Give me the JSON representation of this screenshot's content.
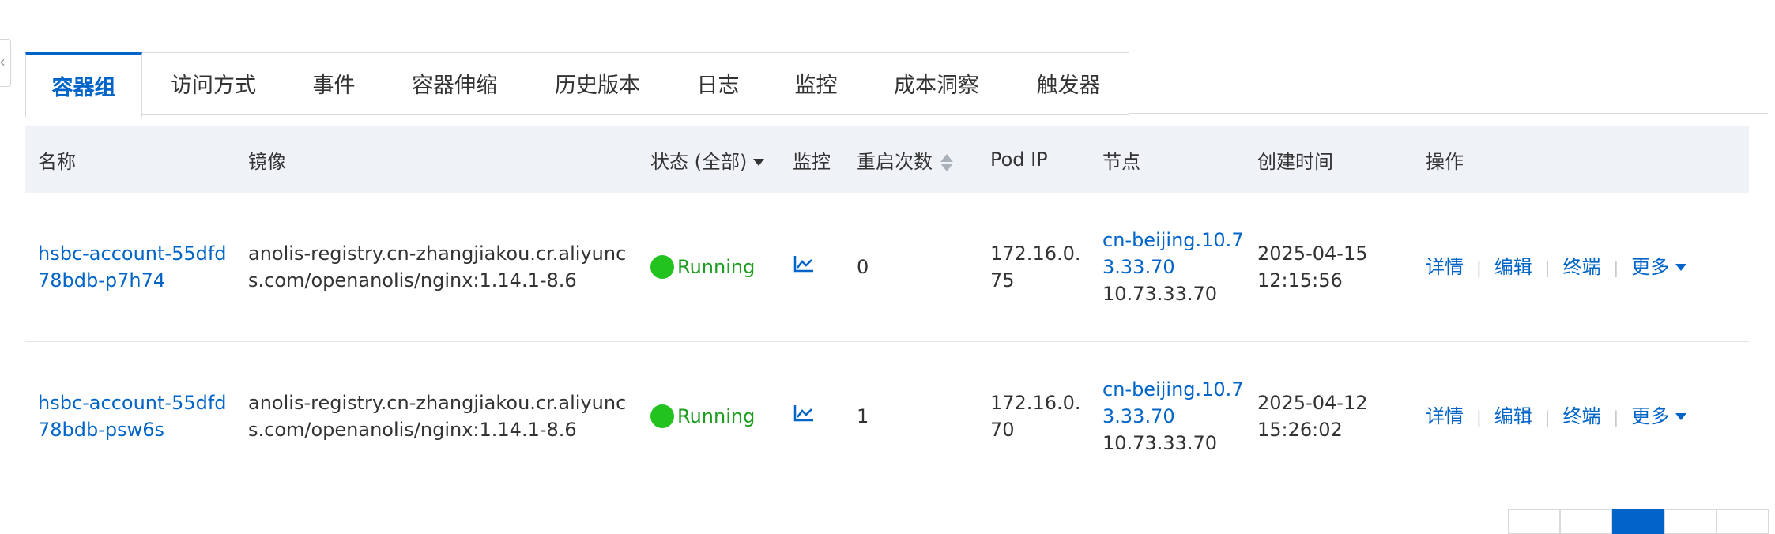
{
  "tabs": [
    "容器组",
    "访问方式",
    "事件",
    "容器伸缩",
    "历史版本",
    "日志",
    "监控",
    "成本洞察",
    "触发器"
  ],
  "table": {
    "headers": {
      "name": "名称",
      "image": "镜像",
      "status": "状态 (全部)",
      "monitor": "监控",
      "restarts": "重启次数",
      "pod_ip": "Pod IP",
      "node": "节点",
      "created": "创建时间",
      "actions": "操作"
    },
    "rows": [
      {
        "name": "hsbc-account-55dfd78bdb-p7h74",
        "image": "anolis-registry.cn-zhangjiakou.cr.aliyuncs.com/openanolis/nginx:1.14.1-8.6",
        "status": "Running",
        "restarts": "0",
        "pod_ip": "172.16.0.75",
        "node_name": "cn-beijing.10.73.33.70",
        "node_ip": "10.73.33.70",
        "created_date": "2025-04-15",
        "created_time": "12:15:56"
      },
      {
        "name": "hsbc-account-55dfd78bdb-psw6s",
        "image": "anolis-registry.cn-zhangjiakou.cr.aliyuncs.com/openanolis/nginx:1.14.1-8.6",
        "status": "Running",
        "restarts": "1",
        "pod_ip": "172.16.0.70",
        "node_name": "cn-beijing.10.73.33.70",
        "node_ip": "10.73.33.70",
        "created_date": "2025-04-12",
        "created_time": "15:26:02"
      }
    ],
    "actions": {
      "details": "详情",
      "edit": "编辑",
      "terminal": "终端",
      "more": "更多"
    }
  },
  "colors": {
    "accent": "#0064c8",
    "running": "#22c31f",
    "header_bg": "#eff3f8"
  },
  "icons": {
    "monitor": "line-chart-icon",
    "collapse": "chevron-left-icon"
  }
}
